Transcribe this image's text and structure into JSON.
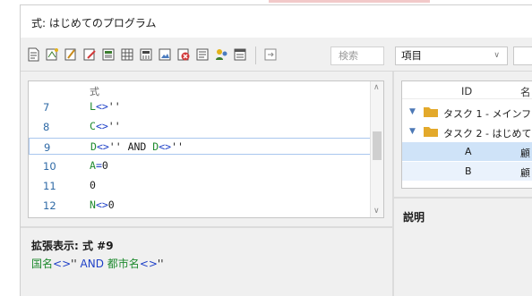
{
  "window": {
    "title": "式: はじめてのプログラム"
  },
  "toolbar": {
    "icons": [
      "new-document-icon",
      "formula-wizard-icon",
      "edit-formula-icon",
      "edit-icon",
      "table-icon",
      "grid-icon",
      "calculator-icon",
      "image-icon",
      "delete-icon",
      "list-icon",
      "users-icon",
      "window-icon",
      "insert-icon"
    ],
    "search_placeholder": "検索",
    "combo_value": "項目"
  },
  "formula": {
    "header": "式",
    "lines": [
      {
        "num": "7",
        "segments": [
          {
            "text": "L",
            "cls": "g"
          },
          {
            "text": "<>",
            "cls": "b"
          },
          {
            "text": "''",
            "cls": "k"
          }
        ]
      },
      {
        "num": "8",
        "segments": [
          {
            "text": "C",
            "cls": "g"
          },
          {
            "text": "<>",
            "cls": "b"
          },
          {
            "text": "''",
            "cls": "k"
          }
        ]
      },
      {
        "num": "9",
        "segments": [
          {
            "text": "D",
            "cls": "g"
          },
          {
            "text": "<>",
            "cls": "b"
          },
          {
            "text": "'' AND ",
            "cls": "k"
          },
          {
            "text": "D",
            "cls": "g"
          },
          {
            "text": "<>",
            "cls": "b"
          },
          {
            "text": "''",
            "cls": "k"
          }
        ],
        "selected": true
      },
      {
        "num": "10",
        "segments": [
          {
            "text": "A",
            "cls": "g"
          },
          {
            "text": "=",
            "cls": "b"
          },
          {
            "text": "0",
            "cls": "k"
          }
        ]
      },
      {
        "num": "11",
        "segments": [
          {
            "text": "0",
            "cls": "k"
          }
        ]
      },
      {
        "num": "12",
        "segments": [
          {
            "text": "N",
            "cls": "g"
          },
          {
            "text": "<>",
            "cls": "b"
          },
          {
            "text": "0",
            "cls": "k"
          }
        ]
      }
    ]
  },
  "expanded": {
    "title": "拡張表示: 式 #9",
    "segments": [
      {
        "text": "国名",
        "cls": "g"
      },
      {
        "text": "<>",
        "cls": "b"
      },
      {
        "text": "'' ",
        "cls": "k"
      },
      {
        "text": "AND ",
        "cls": "b"
      },
      {
        "text": "都市名",
        "cls": "g"
      },
      {
        "text": "<>",
        "cls": "b"
      },
      {
        "text": "''",
        "cls": "k"
      }
    ]
  },
  "tree": {
    "col_id": "ID",
    "col_name": "名",
    "tasks": [
      {
        "label": "タスク 1 - メインフ"
      },
      {
        "label": "タスク 2 - はじめて"
      }
    ],
    "rows": [
      {
        "id": "A",
        "name": "顧"
      },
      {
        "id": "B",
        "name": "顧"
      }
    ]
  },
  "description": {
    "title": "説明"
  },
  "colors": {
    "field": "#1e8a2e",
    "operator": "#1d3fc7",
    "selection_border": "#a9c7ee",
    "row_selected": "#cfe3f8"
  }
}
